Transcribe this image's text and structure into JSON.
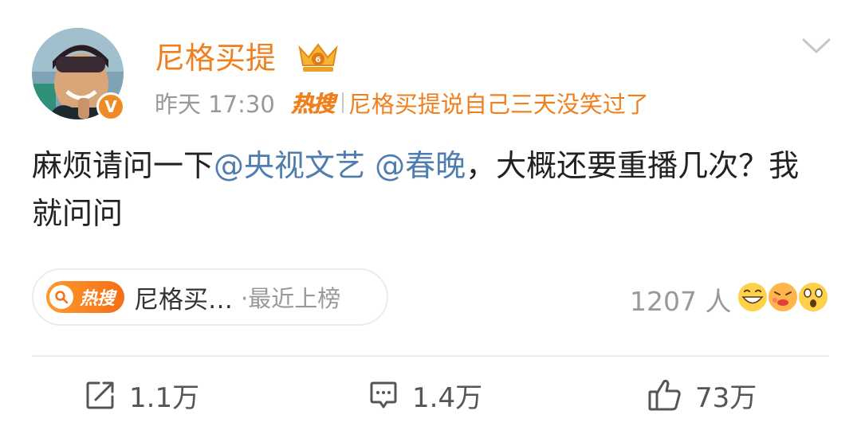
{
  "post": {
    "author": "尼格买提",
    "time": "昨天 17:30",
    "verified_mark": "V",
    "hot_tag": "热搜",
    "hot_text": "尼格买提说自己三天没笑过了",
    "content_before": "麻烦请问一下",
    "mention_1": "@央视文艺",
    "mention_2": "@春晚",
    "content_after": "，大概还要重播几次？我就问问"
  },
  "hot_pill": {
    "badge_label": "热搜",
    "topic": "尼格买…",
    "suffix": "·最近上榜"
  },
  "reactions": {
    "count": "1207 人",
    "emojis": [
      "grin-emoji",
      "kiss-emoji",
      "shock-emoji"
    ]
  },
  "actions": {
    "repost": "1.1万",
    "comment": "1.4万",
    "like": "73万"
  },
  "colors": {
    "brand": "#f07f1d",
    "mention": "#507daf",
    "text": "#222222",
    "muted": "#999999"
  }
}
